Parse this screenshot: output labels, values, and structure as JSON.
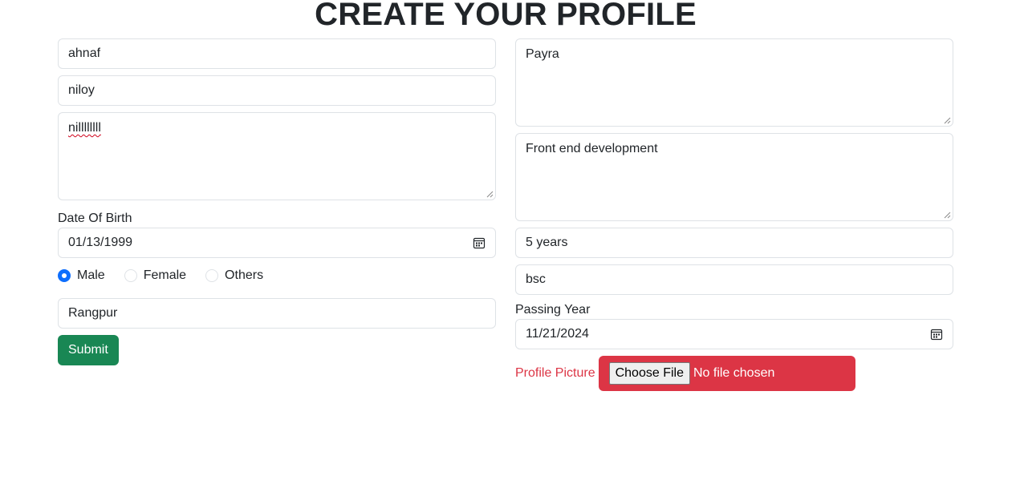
{
  "page": {
    "title": "CREATE YOUR PROFILE"
  },
  "left": {
    "first_name_value": "ahnaf",
    "last_name_value": "niloy",
    "bio_value": "nillllllll",
    "dob_label": "Date Of Birth",
    "dob_value": "01/13/1999",
    "gender_options": [
      "Male",
      "Female",
      "Others"
    ],
    "gender_selected": "Male",
    "city_value": "Rangpur",
    "submit_label": "Submit"
  },
  "right": {
    "institute_value": "Payra",
    "skills_value": "Front end development",
    "experience_value": "5 years",
    "degree_value": "bsc",
    "passing_year_label": "Passing Year",
    "passing_year_value": "11/21/2024",
    "profile_picture_label": "Profile Picture",
    "choose_file_label": "Choose File",
    "file_status": "No file chosen"
  },
  "colors": {
    "accent": "#0d6efd",
    "submit": "#198754",
    "danger": "#dc3545",
    "border": "#dee2e6"
  },
  "icons": {
    "date": "calendar-icon"
  }
}
